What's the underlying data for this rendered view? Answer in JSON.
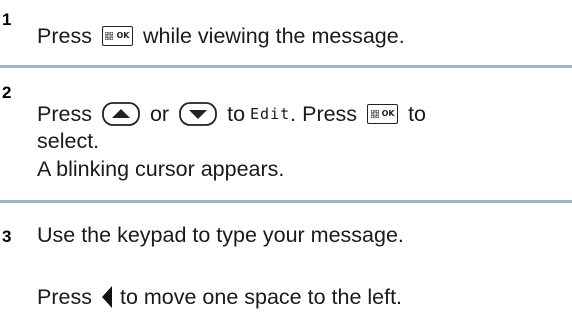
{
  "steps": [
    {
      "number": "1",
      "lines": [
        {
          "before": "Press",
          "key": "ok-icon",
          "key_label": "OK",
          "after": "while viewing the message."
        }
      ]
    },
    {
      "number": "2",
      "line1": {
        "press": "Press",
        "or": "or",
        "to": "to",
        "edit": "Edit",
        "period_press": ". Press",
        "key_label": "OK",
        "tail": "to"
      },
      "line2": "select.",
      "line3": "A blinking cursor appears."
    },
    {
      "number": "3",
      "line1": "Use the keypad to type your message.",
      "line2_before": "Press",
      "line2_after": "to move one space to the left."
    }
  ],
  "icons": [
    "ok-key-icon",
    "up-arrow-key-icon",
    "down-arrow-key-icon",
    "left-arrow-icon"
  ],
  "colors": {
    "divider": "#9fb6c8",
    "text": "#1a1a1a"
  }
}
